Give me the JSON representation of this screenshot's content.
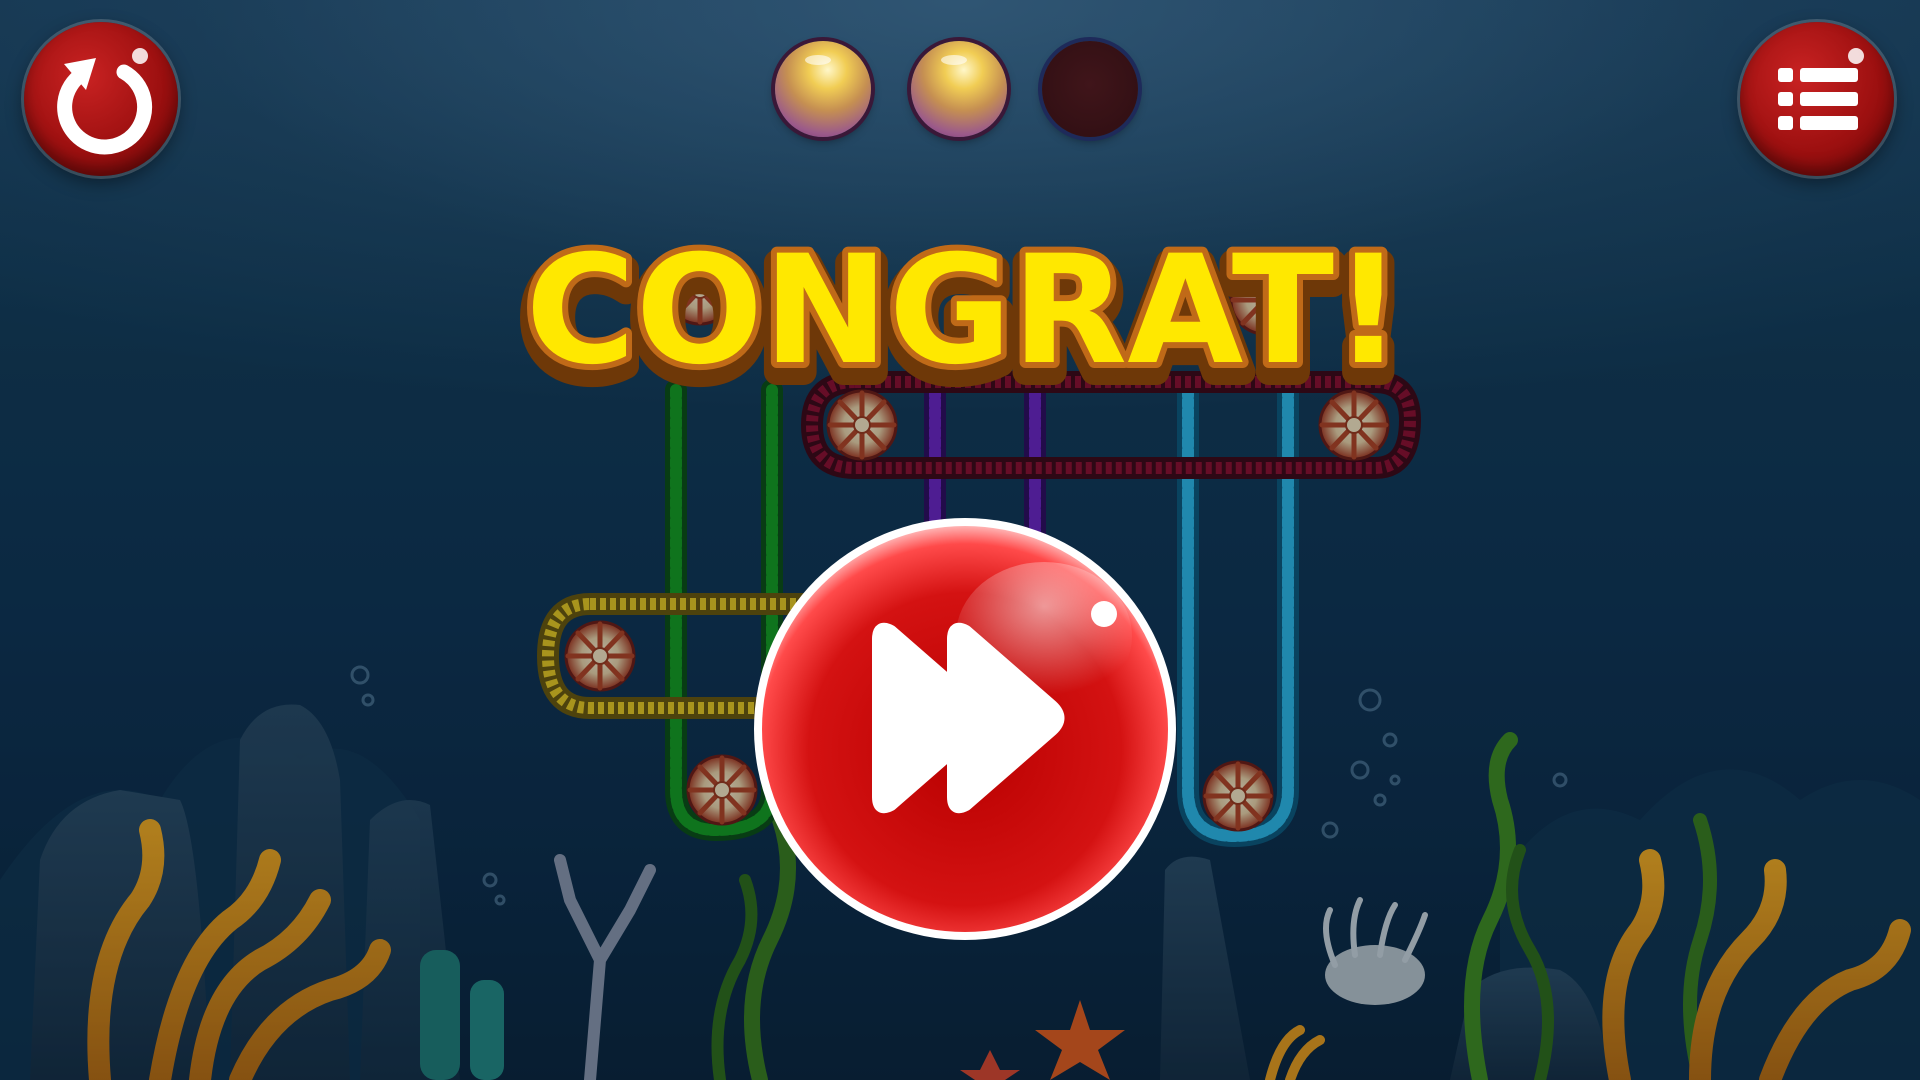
{
  "title": "CONGRAT!",
  "stars": {
    "earned": 2,
    "total": 3
  },
  "colors": {
    "title_fill": "#ffe800",
    "title_stroke": "#b5651d",
    "button_red": "#d91818",
    "tube_green": "#138a18",
    "tube_purple": "#5a1aa0",
    "tube_cyan": "#24a8d8",
    "tube_maroon": "#7a0a24",
    "tube_yellow": "#e6c31a",
    "background": "#0f3250"
  },
  "icons": {
    "restart": "restart-icon",
    "menu": "menu-list-icon",
    "next": "fast-forward-icon"
  }
}
